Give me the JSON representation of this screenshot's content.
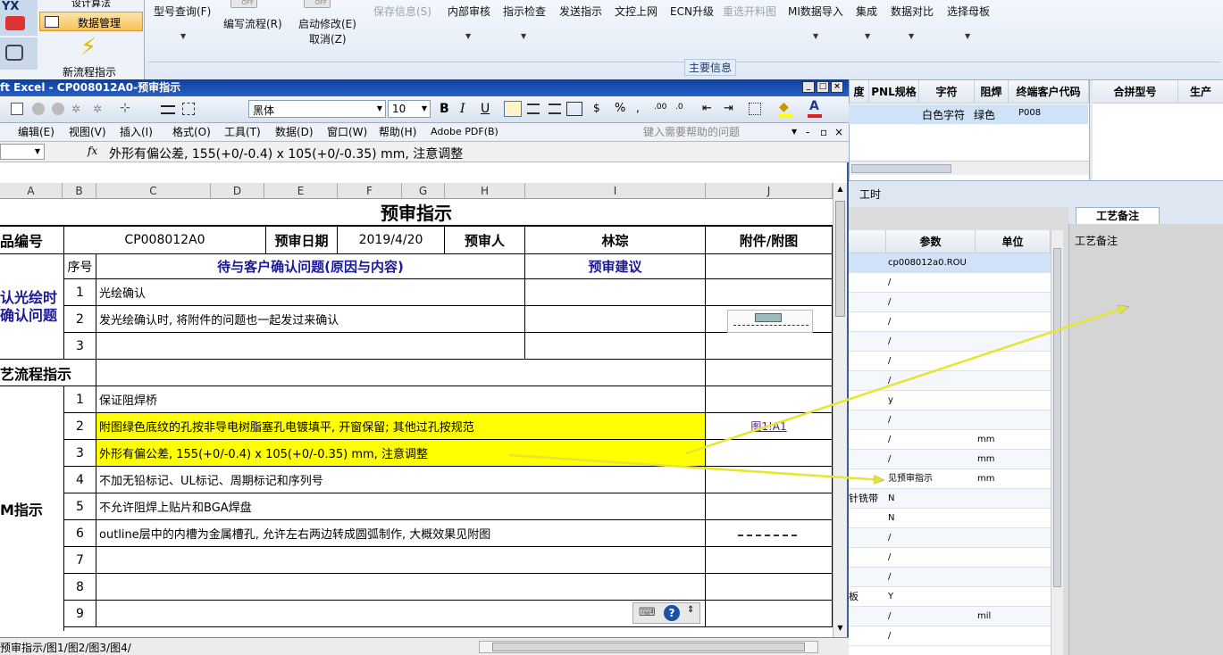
{
  "app": {
    "leftnav": {
      "item_top": "设计算法",
      "item_data": "数据管理",
      "item_new": "新流程指示",
      "logo_text": "YX"
    },
    "ribbon": {
      "buttons": [
        "型号查询(F)",
        "编写流程(R)",
        "启动修改(E)",
        "保存信息(S)",
        "内部审核",
        "指示检查",
        "发送指示",
        "文控上网",
        "ECN升级",
        "重选开料图",
        "MI数据导入",
        "集成",
        "数据对比",
        "选择母板"
      ],
      "cancel": "取消(Z)",
      "toggle_off": "OFF",
      "group_label": "主要信息"
    },
    "top_grid": {
      "headers": [
        "度",
        "PNL规格",
        "字符",
        "阻焊",
        "终端客户代码",
        "合拼型号",
        "生产"
      ],
      "row": [
        "白色字符",
        "绿色",
        "P008"
      ]
    },
    "mid_label": "工时",
    "craft_tab": "工艺备注",
    "craft_label": "工艺备注",
    "param_table": {
      "headers": [
        "参数",
        "单位"
      ],
      "rows": [
        {
          "pre": "",
          "param": "cp008012a0.ROU",
          "unit": ""
        },
        {
          "pre": "",
          "param": "/",
          "unit": ""
        },
        {
          "pre": "",
          "param": "/",
          "unit": ""
        },
        {
          "pre": "",
          "param": "/",
          "unit": ""
        },
        {
          "pre": "",
          "param": "/",
          "unit": ""
        },
        {
          "pre": "",
          "param": "/",
          "unit": ""
        },
        {
          "pre": "",
          "param": "/",
          "unit": ""
        },
        {
          "pre": "",
          "param": "y",
          "unit": ""
        },
        {
          "pre": "",
          "param": "/",
          "unit": ""
        },
        {
          "pre": "",
          "param": "/",
          "unit": "mm"
        },
        {
          "pre": "",
          "param": "/",
          "unit": "mm"
        },
        {
          "pre": "",
          "param": "见预审指示",
          "unit": "mm"
        },
        {
          "pre": "针铣带",
          "param": "N",
          "unit": ""
        },
        {
          "pre": "",
          "param": "N",
          "unit": ""
        },
        {
          "pre": "",
          "param": "/",
          "unit": ""
        },
        {
          "pre": "",
          "param": "/",
          "unit": ""
        },
        {
          "pre": "",
          "param": "/",
          "unit": ""
        },
        {
          "pre": "板",
          "param": "Y",
          "unit": ""
        },
        {
          "pre": "",
          "param": "/",
          "unit": "mil"
        },
        {
          "pre": "",
          "param": "/",
          "unit": ""
        }
      ]
    }
  },
  "excel": {
    "title": "ft Excel - CP008012A0-预审指示",
    "font_name": "黑体",
    "font_size": "10",
    "menu": [
      "编辑(E)",
      "视图(V)",
      "插入(I)",
      "格式(O)",
      "工具(T)",
      "数据(D)",
      "窗口(W)",
      "帮助(H)",
      "Adobe PDF(B)"
    ],
    "help_placeholder": "键入需要帮助的问题",
    "fx": "fx",
    "formula": "外形有偏公差, 155(+0/-0.4) x 105(+0/-0.35) mm, 注意调整",
    "columns": [
      "A",
      "B",
      "C",
      "D",
      "E",
      "F",
      "G",
      "H",
      "I",
      "J"
    ],
    "sheet": {
      "title": "预审指示",
      "label_pn": "品编号",
      "pn": "CP008012A0",
      "label_date": "预审日期",
      "date": "2019/4/20",
      "label_reviewer": "预审人",
      "reviewer": "林琮",
      "label_attach": "附件/附图",
      "seq_header": "序号",
      "issue_header": "待与客户确认问题(原因与内容)",
      "advice_header": "预审建议",
      "confirm_section": "认光绘时\n确认问题",
      "confirm_rows": [
        {
          "n": "1",
          "text": "光绘确认"
        },
        {
          "n": "2",
          "text": "发光绘确认时, 将附件的问题也一起发过来确认"
        },
        {
          "n": "3",
          "text": ""
        }
      ],
      "process_section": "艺流程指示",
      "cam_section": "M指示",
      "cam_rows": [
        {
          "n": "1",
          "text": "保证阻焊桥",
          "link": ""
        },
        {
          "n": "2",
          "text": "附图绿色底纹的孔按非导电树脂塞孔电镀填平, 开窗保留; 其他过孔按规范",
          "link": "图1!A1"
        },
        {
          "n": "3",
          "text": "外形有偏公差, 155(+0/-0.4) x 105(+0/-0.35) mm, 注意调整",
          "link": ""
        },
        {
          "n": "4",
          "text": "不加无铅标记、UL标记、周期标记和序列号",
          "link": ""
        },
        {
          "n": "5",
          "text": "不允许阻焊上贴片和BGA焊盘",
          "link": ""
        },
        {
          "n": "6",
          "text": "outline层中的内槽为金属槽孔, 允许左右两边转成圆弧制作, 大概效果见附图",
          "link": ""
        },
        {
          "n": "7",
          "text": "",
          "link": ""
        },
        {
          "n": "8",
          "text": "",
          "link": ""
        },
        {
          "n": "9",
          "text": "",
          "link": ""
        }
      ]
    },
    "tabs": "预审指示/图1/图2/图3/图4/"
  },
  "colors": {
    "title_bar": "#0b3f9e",
    "highlight": "#ffff00",
    "arrow": "#e6e62e",
    "ribbon": "#dfe9f6"
  }
}
